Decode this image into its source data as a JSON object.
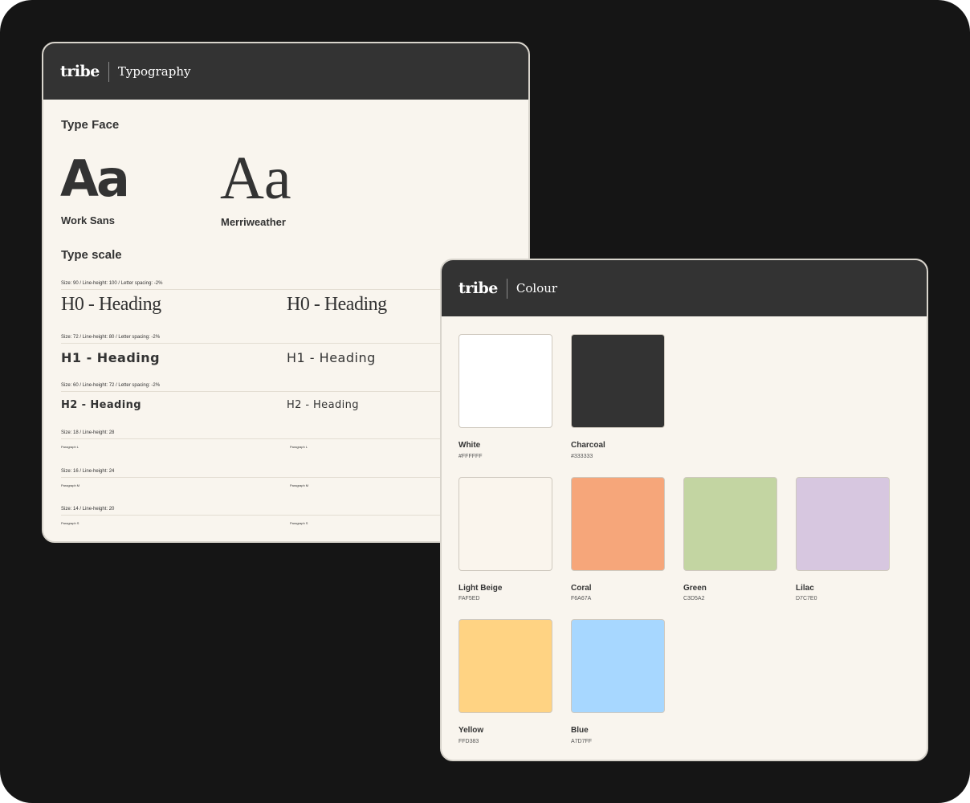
{
  "typography_card": {
    "logo": "tribe",
    "title": "Typography",
    "type_face_title": "Type Face",
    "sample_glyphs": "Aa",
    "font_sans": "Work Sans",
    "font_serif": "Merriweather",
    "type_scale_title": "Type scale",
    "scale": [
      {
        "spec": "Size: 90 / Line-height: 100 / Letter spacing: -2%",
        "left": "H0 - Heading",
        "right": "H0 - Heading"
      },
      {
        "spec": "Size: 72 / Line-height: 80 / Letter spacing: -2%",
        "left": "H1 - Heading",
        "right": "H1 - Heading"
      },
      {
        "spec": "Size: 60 / Line-height: 72 / Letter spacing: -2%",
        "left": "H2 - Heading",
        "right": "H2 - Heading"
      },
      {
        "spec": "Size: 18 / Line-height: 28",
        "left": "Paragraph L",
        "right": "Paragraph L"
      },
      {
        "spec": "Size: 16 / Line-height: 24",
        "left": "Paragraph M",
        "right": "Paragraph M"
      },
      {
        "spec": "Size: 14 / Line-height: 20",
        "left": "Paragraph S",
        "right": "Paragraph S"
      }
    ]
  },
  "colour_card": {
    "logo": "tribe",
    "title": "Colour",
    "swatches": [
      {
        "name": "White",
        "hex": "#FFFFFF",
        "color": "#FFFFFF"
      },
      {
        "name": "Charcoal",
        "hex": "#333333",
        "color": "#333333"
      },
      {
        "name": "Light Beige",
        "hex": "FAF5ED",
        "color": "#FAF5ED"
      },
      {
        "name": "Coral",
        "hex": "F6A67A",
        "color": "#F6A67A"
      },
      {
        "name": "Green",
        "hex": "C3D5A2",
        "color": "#C3D5A2"
      },
      {
        "name": "Lilac",
        "hex": "D7C7E0",
        "color": "#D7C7E0"
      },
      {
        "name": "Yellow",
        "hex": "FFD383",
        "color": "#FFD383"
      },
      {
        "name": "Blue",
        "hex": "A7D7FF",
        "color": "#A7D7FF"
      }
    ]
  }
}
